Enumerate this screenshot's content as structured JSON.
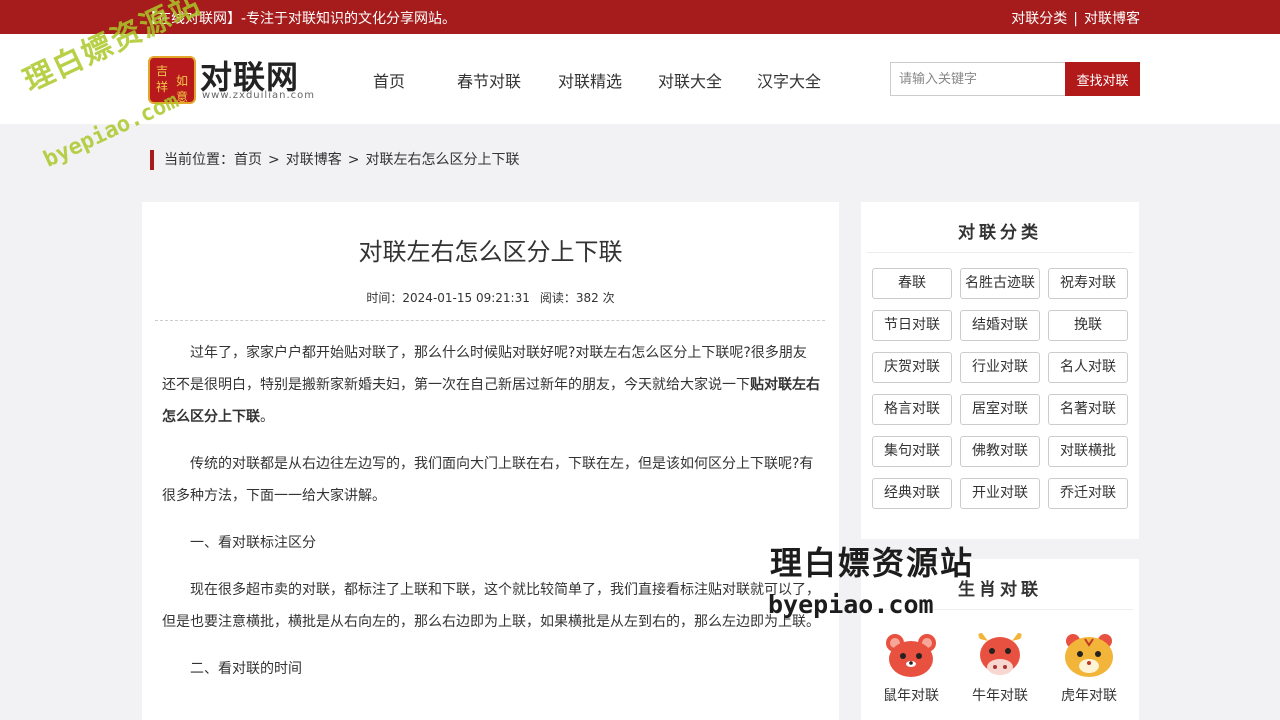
{
  "topbar": {
    "slogan": "【在线对联网】-专注于对联知识的文化分享网站。",
    "links": [
      "对联分类",
      "对联博客"
    ],
    "separator": "|"
  },
  "logo": {
    "name": "对联网",
    "domain": "www.zxduilian.com",
    "badge_chars": [
      "吉",
      "祥",
      "如",
      "意"
    ]
  },
  "nav": [
    "首页",
    "春节对联",
    "对联精选",
    "对联大全",
    "汉字大全"
  ],
  "search": {
    "placeholder": "请输入关键字",
    "button": "查找对联"
  },
  "breadcrumb": {
    "prefix": "当前位置：",
    "items": [
      "首页",
      "对联博客",
      "对联左右怎么区分上下联"
    ],
    "arrow": ">"
  },
  "article": {
    "title": "对联左右怎么区分上下联",
    "time_label": "时间：",
    "time": "2024-01-15 09:21:31",
    "read_label": "阅读：",
    "read_count": "382 次",
    "p1_text": "过年了，家家户户都开始贴对联了，那么什么时候贴对联好呢?对联左右怎么区分上下联呢?很多朋友还不是很明白，特别是搬新家新婚夫妇，第一次在自己新居过新年的朋友，今天就给大家说一下",
    "p1_bold": "贴对联左右怎么区分上下联",
    "p1_end": "。",
    "p2": "传统的对联都是从右边往左边写的，我们面向大门上联在右，下联在左，但是该如何区分上下联呢?有很多种方法，下面一一给大家讲解。",
    "p3": "一、看对联标注区分",
    "p4": "现在很多超市卖的对联，都标注了上联和下联，这个就比较简单了，我们直接看标注贴对联就可以了，但是也要注意横批，横批是从右向左的，那么右边即为上联，如果横批是从左到右的，那么左边即为上联。",
    "p5": "二、看对联的时间"
  },
  "sidebar_categories": {
    "title": "对联分类",
    "tags": [
      "春联",
      "名胜古迹联",
      "祝寿对联",
      "节日对联",
      "结婚对联",
      "挽联",
      "庆贺对联",
      "行业对联",
      "名人对联",
      "格言对联",
      "居室对联",
      "名著对联",
      "集句对联",
      "佛教对联",
      "对联横批",
      "经典对联",
      "开业对联",
      "乔迁对联"
    ]
  },
  "sidebar_zodiac": {
    "title": "生肖对联",
    "items": [
      {
        "label": "鼠年对联",
        "icon": "rat-icon",
        "color": "#e8513f"
      },
      {
        "label": "牛年对联",
        "icon": "ox-icon",
        "color": "#e8513f"
      },
      {
        "label": "虎年对联",
        "icon": "tiger-icon",
        "color": "#f2b53a"
      }
    ]
  },
  "watermark": {
    "text_cn": "理白嫖资源站",
    "text_en": "byepiao.com"
  },
  "colors": {
    "brand_red": "#a61c1c",
    "button_red": "#b21a1a"
  }
}
